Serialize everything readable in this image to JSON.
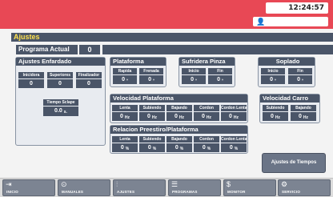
{
  "header": {
    "clock": "12:24:57",
    "user_icon": "user-icon"
  },
  "title": "Ajustes",
  "programa": {
    "label": "Programa Actual",
    "value": "0"
  },
  "enfardado": {
    "title": "Ajustes Enfardado",
    "fields": [
      {
        "label": "Inicidora",
        "value": "0"
      },
      {
        "label": "Superiores",
        "value": "0"
      },
      {
        "label": "Finalizador",
        "value": "0"
      }
    ],
    "tiempo_label": "Tiempo Sclape",
    "tiempo_value": "0.0",
    "tiempo_unit": "s."
  },
  "plataforma": {
    "title": "Plataforma",
    "fields": [
      {
        "label": "Rapida",
        "value": "0",
        "unit": "º"
      },
      {
        "label": "Frenada",
        "value": "0",
        "unit": "º"
      }
    ]
  },
  "sufridera": {
    "title": "Sufridera Pinza",
    "fields": [
      {
        "label": "Inicio",
        "value": "0",
        "unit": "º"
      },
      {
        "label": "Fin",
        "value": "0",
        "unit": "º"
      }
    ]
  },
  "soplado": {
    "title": "Soplado",
    "fields": [
      {
        "label": "Inicio",
        "value": "0",
        "unit": "º"
      },
      {
        "label": "Fin",
        "value": "0",
        "unit": "º"
      }
    ]
  },
  "velocidad_plataforma": {
    "title": "Velocidad Plataforma",
    "fields": [
      {
        "label": "Lenta",
        "value": "0",
        "unit": "Hz"
      },
      {
        "label": "Subiendo",
        "value": "0",
        "unit": "Hz"
      },
      {
        "label": "Bajando",
        "value": "0",
        "unit": "Hz"
      },
      {
        "label": "Cordon",
        "value": "0",
        "unit": "Hz"
      },
      {
        "label": "Cordon Lenta",
        "value": "0",
        "unit": "Hz"
      }
    ]
  },
  "velocidad_carro": {
    "title": "Velocidad Carro",
    "fields": [
      {
        "label": "Subiendo",
        "value": "0",
        "unit": "Hz"
      },
      {
        "label": "Bajando",
        "value": "0",
        "unit": "Hz"
      }
    ]
  },
  "relacion": {
    "title": "Relacion Preestiro/Plataforma",
    "fields": [
      {
        "label": "Lenta",
        "value": "0",
        "unit": "%"
      },
      {
        "label": "Subiendo",
        "value": "0",
        "unit": "%"
      },
      {
        "label": "Bajando",
        "value": "0",
        "unit": "%"
      },
      {
        "label": "Cordon",
        "value": "0",
        "unit": "%"
      },
      {
        "label": "Cordon Lenta",
        "value": "0",
        "unit": "%"
      }
    ]
  },
  "ajustes_tiempos_button": "Ajustes de Tiempos",
  "nav": [
    {
      "label": "INICIO",
      "icon": "exit-icon",
      "glyph": "⇥"
    },
    {
      "label": "MANUALES",
      "icon": "manual-icon",
      "glyph": "⊙"
    },
    {
      "label": "AJUSTES",
      "icon": "sliders-icon",
      "glyph": "⫶"
    },
    {
      "label": "PROGRAMAS",
      "icon": "list-icon",
      "glyph": "☰"
    },
    {
      "label": "MONITOR",
      "icon": "dollar-icon",
      "glyph": "$"
    },
    {
      "label": "SERVICIO",
      "icon": "gear-icon",
      "glyph": "⚙"
    }
  ]
}
